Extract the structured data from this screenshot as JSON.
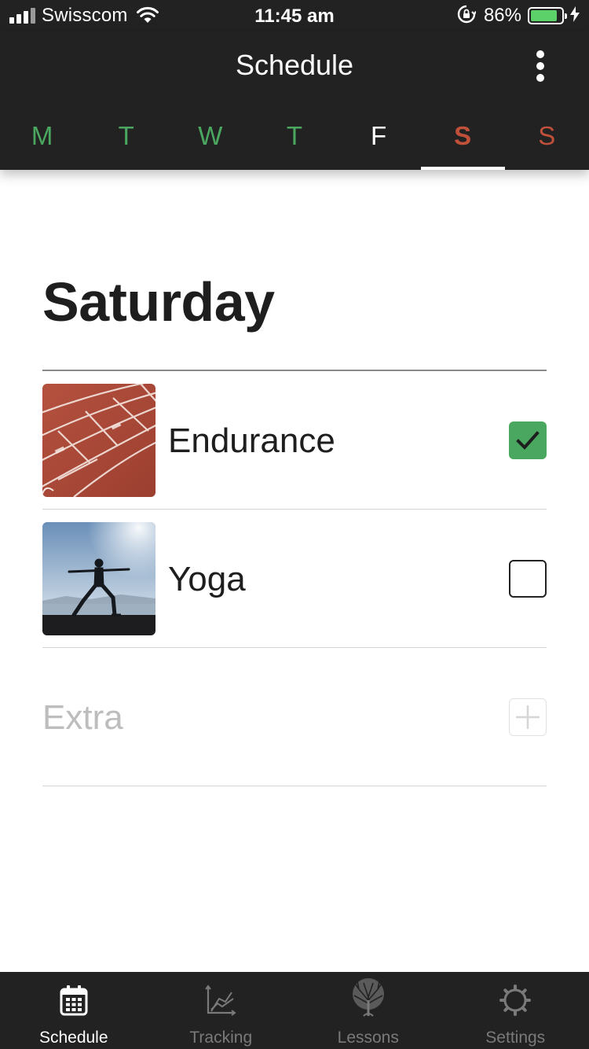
{
  "status_bar": {
    "carrier": "Swisscom",
    "time": "11:45 am",
    "battery_percent": "86%",
    "battery_level": 0.86
  },
  "header": {
    "title": "Schedule",
    "more_icon": "more-vertical-icon"
  },
  "day_tabs": [
    {
      "label": "M",
      "color": "#4aa760"
    },
    {
      "label": "T",
      "color": "#4aa760"
    },
    {
      "label": "W",
      "color": "#4aa760"
    },
    {
      "label": "T",
      "color": "#4aa760"
    },
    {
      "label": "F",
      "color": "#ffffff"
    },
    {
      "label": "S",
      "color": "#c0503a",
      "selected": true
    },
    {
      "label": "S",
      "color": "#c0503a"
    }
  ],
  "content": {
    "day_title": "Saturday",
    "activities": [
      {
        "name": "Endurance",
        "image": "running-track-photo",
        "checked": true
      },
      {
        "name": "Yoga",
        "image": "yoga-pose-photo",
        "checked": false
      }
    ],
    "extra": {
      "label": "Extra",
      "icon": "plus-icon"
    }
  },
  "tab_bar": [
    {
      "label": "Schedule",
      "icon": "calendar-icon",
      "active": true
    },
    {
      "label": "Tracking",
      "icon": "chart-icon",
      "active": false
    },
    {
      "label": "Lessons",
      "icon": "tree-icon",
      "active": false
    },
    {
      "label": "Settings",
      "icon": "gear-icon",
      "active": false
    }
  ],
  "colors": {
    "header_bg": "#222222",
    "accent_green": "#4aa760",
    "weekend_red": "#c0503a",
    "battery_green": "#5cd169"
  }
}
